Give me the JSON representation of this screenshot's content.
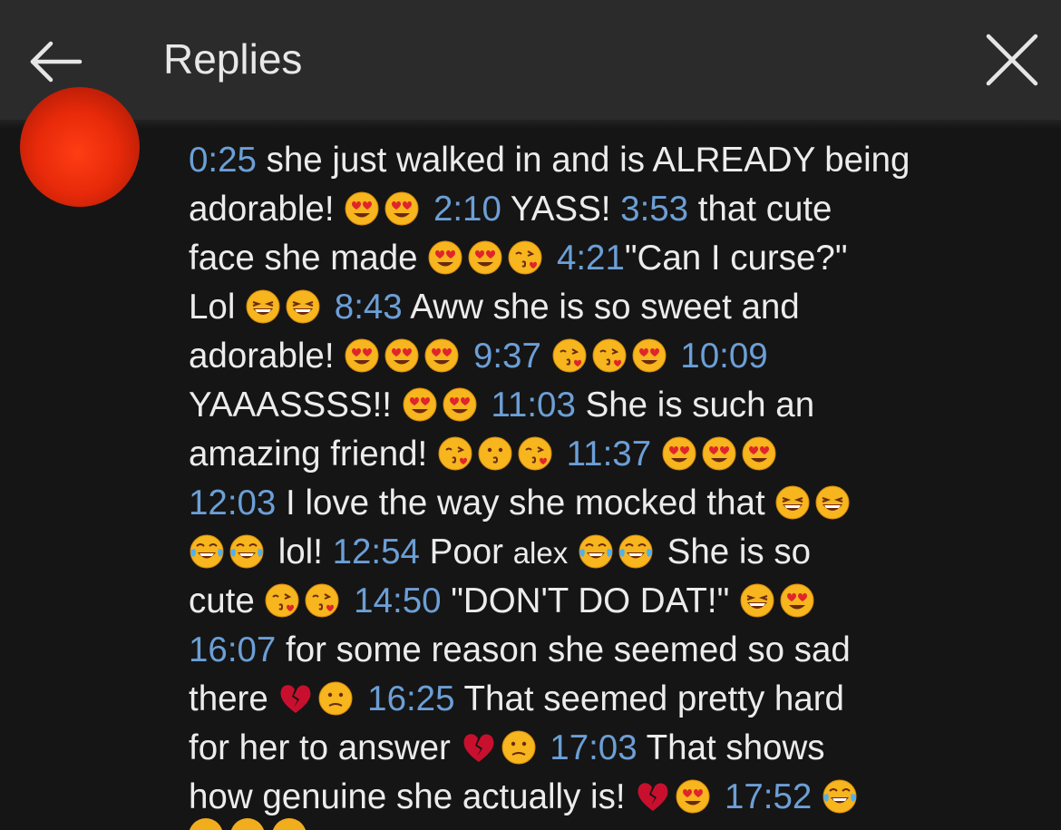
{
  "header": {
    "title": "Replies",
    "back_icon": "arrow-left-icon",
    "close_icon": "close-x-icon"
  },
  "colors": {
    "header_bg": "#2b2b2b",
    "body_bg": "#151515",
    "text": "#ececec",
    "timestamp": "#6c9fd6",
    "avatar": "#e82a0a"
  },
  "comment": {
    "lines": [
      [
        {
          "ts": "0:25"
        },
        {
          "t": " she just walked in and is ALREADY being"
        }
      ],
      [
        {
          "t": "adorable! "
        },
        {
          "e": "heart-eyes-icon"
        },
        {
          "e": "heart-eyes-icon"
        },
        {
          "t": " "
        },
        {
          "ts": "2:10"
        },
        {
          "t": " YASS! "
        },
        {
          "ts": "3:53"
        },
        {
          "t": " that cute"
        }
      ],
      [
        {
          "t": "face she made "
        },
        {
          "e": "heart-eyes-icon"
        },
        {
          "e": "heart-eyes-icon"
        },
        {
          "e": "kissing-heart-icon"
        },
        {
          "t": " "
        },
        {
          "ts": "4:21"
        },
        {
          "t": "\"Can I curse?\""
        }
      ],
      [
        {
          "t": "Lol "
        },
        {
          "e": "laughing-icon"
        },
        {
          "e": "laughing-icon"
        },
        {
          "t": " "
        },
        {
          "ts": "8:43"
        },
        {
          "t": " Aww she is so sweet and"
        }
      ],
      [
        {
          "t": "adorable! "
        },
        {
          "e": "heart-eyes-icon"
        },
        {
          "e": "heart-eyes-icon"
        },
        {
          "e": "heart-eyes-icon"
        },
        {
          "t": " "
        },
        {
          "ts": "9:37"
        },
        {
          "t": " "
        },
        {
          "e": "kissing-heart-icon"
        },
        {
          "e": "kissing-heart-icon"
        },
        {
          "e": "heart-eyes-icon"
        },
        {
          "t": " "
        },
        {
          "ts": "10:09"
        }
      ],
      [
        {
          "t": "YAAASSSS!! "
        },
        {
          "e": "heart-eyes-icon"
        },
        {
          "e": "heart-eyes-icon"
        },
        {
          "t": " "
        },
        {
          "ts": "11:03"
        },
        {
          "t": " She is such an"
        }
      ],
      [
        {
          "t": "amazing friend! "
        },
        {
          "e": "kissing-heart-icon"
        },
        {
          "e": "kissing-icon"
        },
        {
          "e": "kissing-heart-icon"
        },
        {
          "t": " "
        },
        {
          "ts": "11:37"
        },
        {
          "t": " "
        },
        {
          "e": "heart-eyes-icon"
        },
        {
          "e": "heart-eyes-icon"
        },
        {
          "e": "heart-eyes-icon"
        }
      ],
      [
        {
          "ts": "12:03"
        },
        {
          "t": " I love the way she mocked that "
        },
        {
          "e": "laughing-icon"
        },
        {
          "e": "laughing-icon"
        }
      ],
      [
        {
          "e": "joy-icon"
        },
        {
          "e": "joy-icon"
        },
        {
          "t": " lol! "
        },
        {
          "ts": "12:54"
        },
        {
          "t": " Poor "
        },
        {
          "n": "alex"
        },
        {
          "t": " "
        },
        {
          "e": "joy-icon"
        },
        {
          "e": "joy-icon"
        },
        {
          "t": " She is so"
        }
      ],
      [
        {
          "t": "cute "
        },
        {
          "e": "kissing-heart-icon"
        },
        {
          "e": "kissing-heart-icon"
        },
        {
          "t": " "
        },
        {
          "ts": "14:50"
        },
        {
          "t": " \"DON'T DO DAT!\" "
        },
        {
          "e": "laughing-icon"
        },
        {
          "e": "heart-eyes-icon"
        }
      ],
      [
        {
          "ts": "16:07"
        },
        {
          "t": " for some reason she seemed so sad"
        }
      ],
      [
        {
          "t": "there "
        },
        {
          "e": "broken-heart-icon"
        },
        {
          "e": "confused-face-icon"
        },
        {
          "t": " "
        },
        {
          "ts": "16:25"
        },
        {
          "t": " That seemed pretty hard"
        }
      ],
      [
        {
          "t": "for her to answer "
        },
        {
          "e": "broken-heart-icon"
        },
        {
          "e": "confused-face-icon"
        },
        {
          "t": " "
        },
        {
          "ts": "17:03"
        },
        {
          "t": " That shows"
        }
      ],
      [
        {
          "t": "how genuine she actually is! "
        },
        {
          "e": "broken-heart-icon"
        },
        {
          "e": "heart-eyes-icon"
        },
        {
          "t": " "
        },
        {
          "ts": "17:52"
        },
        {
          "t": " "
        },
        {
          "e": "joy-icon"
        }
      ]
    ]
  }
}
